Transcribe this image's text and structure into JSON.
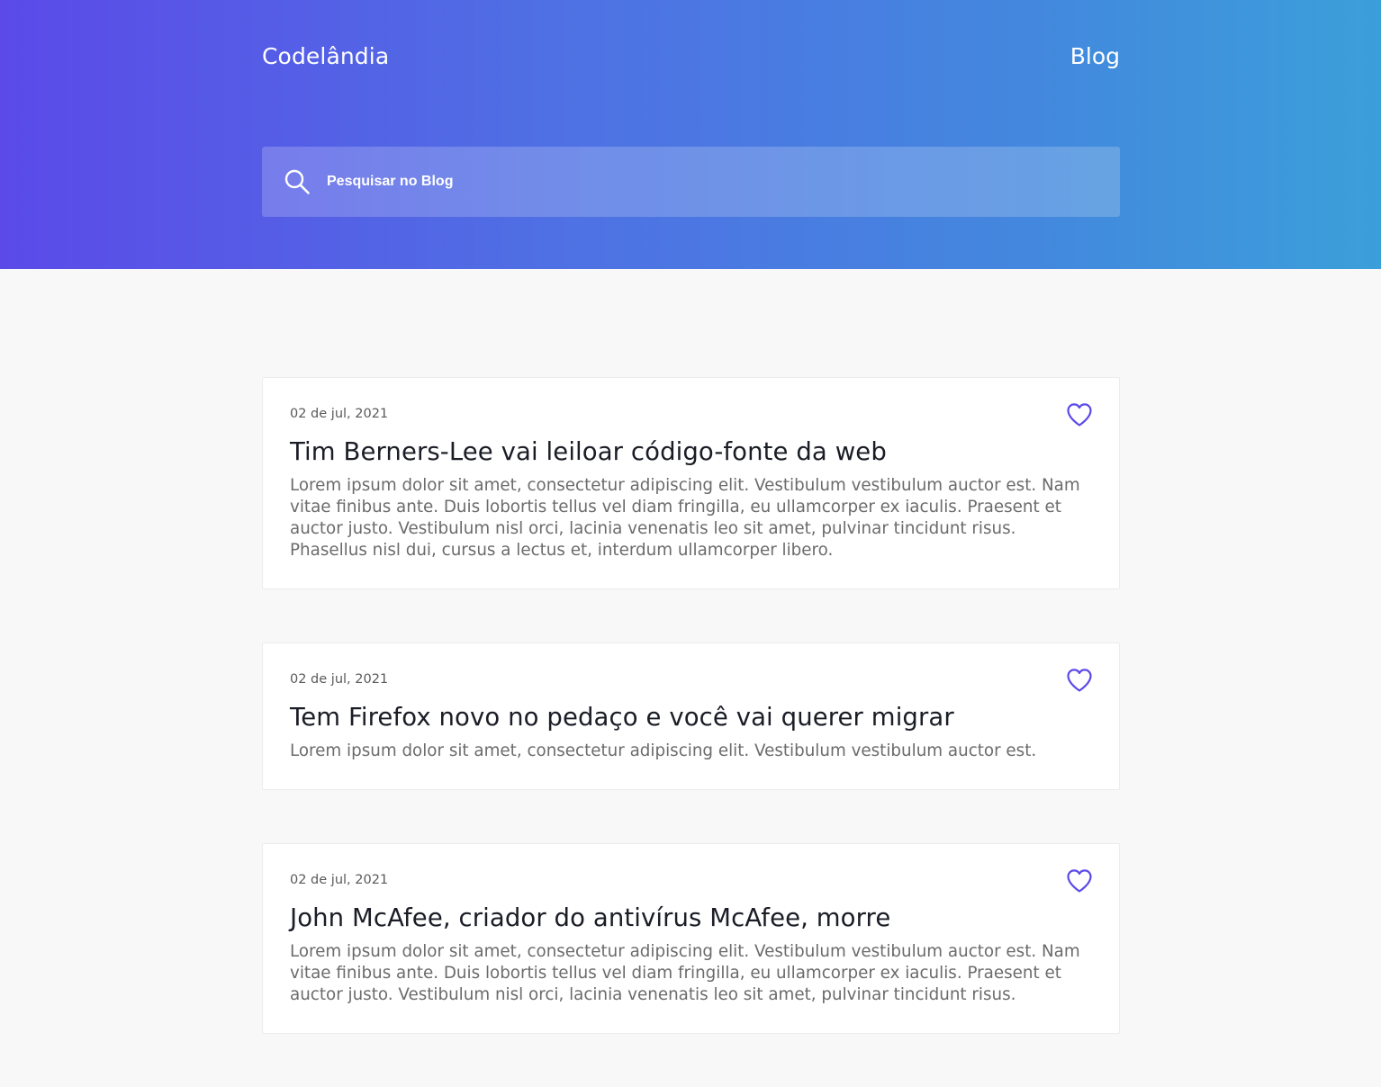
{
  "header": {
    "brand": "Codelândia",
    "nav_blog": "Blog",
    "search_placeholder": "Pesquisar no Blog"
  },
  "icons": {
    "search": "search-icon",
    "like": "heart-icon"
  },
  "colors": {
    "gradient_start": "#5b4ae8",
    "gradient_end": "#3b9fda",
    "accent": "#5b4ae8",
    "background": "#f8f8f8"
  },
  "posts": [
    {
      "date": "02 de jul, 2021",
      "title": "Tim Berners-Lee vai leiloar código-fonte da web",
      "excerpt": "Lorem ipsum dolor sit amet, consectetur adipiscing elit. Vestibulum vestibulum auctor est. Nam vitae finibus ante. Duis lobortis tellus vel diam fringilla, eu ullamcorper ex iaculis. Praesent et auctor justo. Vestibulum nisl orci, lacinia venenatis leo sit amet, pulvinar tincidunt risus. Phasellus nisl dui, cursus a lectus et, interdum ullamcorper libero."
    },
    {
      "date": "02 de jul, 2021",
      "title": "Tem Firefox novo no pedaço e você vai querer migrar",
      "excerpt": "Lorem ipsum dolor sit amet, consectetur adipiscing elit. Vestibulum vestibulum auctor est."
    },
    {
      "date": "02 de jul, 2021",
      "title": "John McAfee, criador do antivírus McAfee, morre",
      "excerpt": "Lorem ipsum dolor sit amet, consectetur adipiscing elit. Vestibulum vestibulum auctor est. Nam vitae finibus ante. Duis lobortis tellus vel diam fringilla, eu ullamcorper ex iaculis. Praesent et auctor justo. Vestibulum nisl orci, lacinia venenatis leo sit amet, pulvinar tincidunt risus."
    }
  ]
}
